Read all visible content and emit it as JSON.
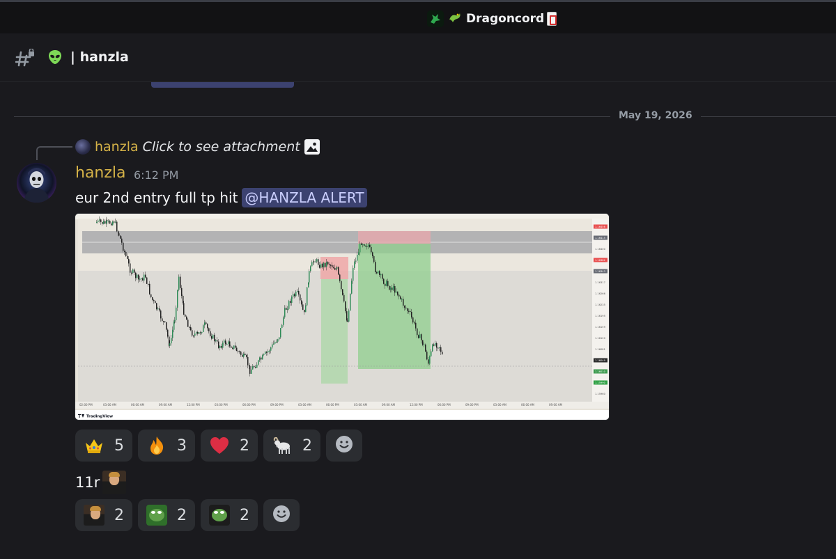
{
  "server": {
    "name": "Dragoncord"
  },
  "channel": {
    "name": "hanzla",
    "separator": "|"
  },
  "date_divider": "May 19, 2026",
  "reply": {
    "author": "hanzla",
    "text": "Click to see attachment"
  },
  "message": {
    "author": "hanzla",
    "time": "6:12 PM",
    "text": "eur 2nd entry full tp hit",
    "mention": "@HANZLA ALERT",
    "attachment_footer": "TradingView",
    "attachment_price_labels": [
      "1.16456",
      "1.16415",
      "1.16400",
      "1.16382",
      "1.16343",
      "1.16317",
      "1.16266",
      "1.16235",
      "1.16195",
      "1.16159",
      "1.16120",
      "1.16081",
      "1.16049",
      "1.16010",
      "1.15990",
      "1.15960"
    ]
  },
  "reactions": [
    {
      "emoji": "crown-icon",
      "count": "5"
    },
    {
      "emoji": "fire-icon",
      "count": "3"
    },
    {
      "emoji": "heart-icon",
      "count": "2"
    },
    {
      "emoji": "goat-icon",
      "count": "2"
    }
  ],
  "message2": {
    "text": "11r"
  },
  "reactions2": [
    {
      "emoji": "cheers-icon",
      "count": "2"
    },
    {
      "emoji": "pepe-icon",
      "count": "2"
    },
    {
      "emoji": "pepe-suit-icon",
      "count": "2"
    }
  ],
  "colors": {
    "background": "#1a1a1e",
    "username": "#d6b348",
    "mention_bg": "#3c4270",
    "reaction_bg": "#2b2d31"
  }
}
